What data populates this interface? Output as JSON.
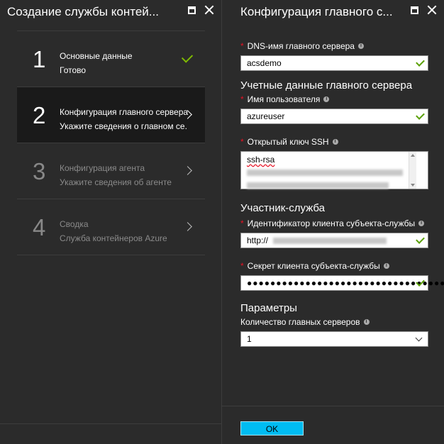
{
  "left_blade": {
    "title": "Создание службы контей...",
    "steps": [
      {
        "number": "1",
        "title": "Основные данные",
        "subtitle": "Готово",
        "state": "done"
      },
      {
        "number": "2",
        "title": "Конфигурация главного сервера",
        "subtitle": "Укажите сведения о главном се...",
        "state": "active"
      },
      {
        "number": "3",
        "title": "Конфигурация агента",
        "subtitle": "Укажите сведения об агенте",
        "state": "disabled"
      },
      {
        "number": "4",
        "title": "Сводка",
        "subtitle": "Служба контейнеров Azure",
        "state": "disabled"
      }
    ]
  },
  "right_blade": {
    "title": "Конфигурация главного с...",
    "dns_label": "DNS-имя главного сервера",
    "dns_value": "acsdemo",
    "section_credentials": "Учетные данные главного сервера",
    "username_label": "Имя пользователя",
    "username_value": "azureuser",
    "ssh_label": "Открытый ключ SSH",
    "ssh_value": "ssh-rsa",
    "section_principal": "Участник-служба",
    "client_id_label": "Идентификатор клиента субъекта-службы",
    "client_id_value": "http://",
    "client_secret_label": "Секрет клиента субъекта-службы",
    "client_secret_value": "●●●●●●●●●●●●●●●●●●●●●●●●●●●●●●●●●●●●",
    "section_params": "Параметры",
    "master_count_label": "Количество главных серверов",
    "master_count_value": "1",
    "ok_label": "OK"
  },
  "colors": {
    "accent": "#00bcf2",
    "check": "#7fba00",
    "required": "#e81123",
    "background": "#2b2b2b",
    "active_step": "#1a1a1a"
  }
}
